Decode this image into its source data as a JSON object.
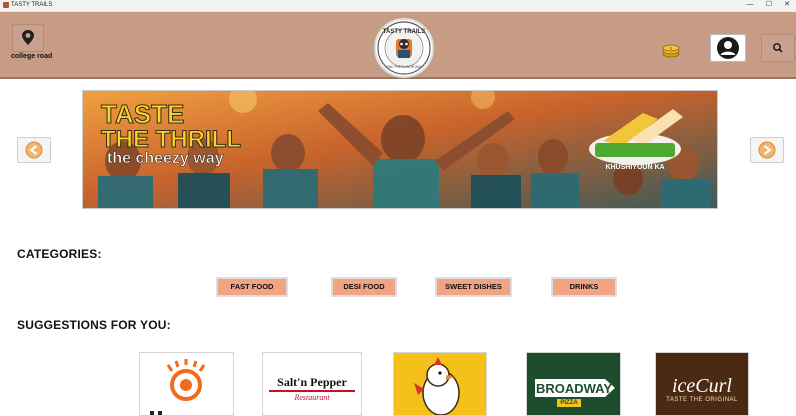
{
  "window": {
    "title": "TASTY TRAILS",
    "minimize": "—",
    "maximize": "☐",
    "close": "✕"
  },
  "header": {
    "location_label": "college road",
    "logo_text": "TASTY TRAILS",
    "logo_tagline": "FIND THE FLAVOR WAY"
  },
  "banner": {
    "headline_line1": "TASTE",
    "headline_line2": "THE THRILL",
    "headline_line3": "the cheezy way",
    "brand": "KHUSHIYOUN KA",
    "colors": {
      "yellow": "#f5d52a",
      "teal": "#2c6b74",
      "green": "#4caa33"
    }
  },
  "categories": {
    "title": "CATEGORIES:",
    "items": [
      "FAST FOOD",
      "DESI FOOD",
      "SWEET DISHES",
      "DRINKS"
    ]
  },
  "suggestions": {
    "title": "SUGGESTIONS FOR YOU:",
    "cards": [
      {
        "name": "orange-eye-logo"
      },
      {
        "name": "Salt'n Pepper",
        "sub": "Restaurant"
      },
      {
        "name": "chicken-mascot-logo"
      },
      {
        "name": "BROADWAY",
        "sub": "PIZZA"
      },
      {
        "name": "iceCurl",
        "sub": "TASTE THE ORIGINAL"
      }
    ]
  },
  "colors": {
    "header": "#c69c84",
    "category_button": "#f1a383"
  }
}
